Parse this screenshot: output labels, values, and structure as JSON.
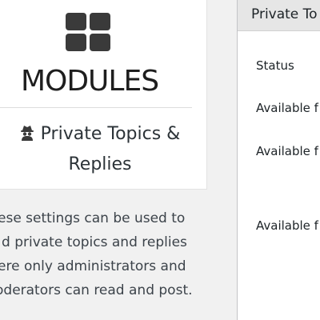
{
  "module_card": {
    "icon": "modules-grid-icon",
    "title": "MODULES",
    "module_icon": "spy-icon",
    "module_name": "Private Topics & Replies"
  },
  "description": {
    "lines": [
      "ese settings can be used to",
      "d private topics and replies",
      "ere only administrators and",
      "oderators can read and post."
    ]
  },
  "settings_panel": {
    "title": "Private To",
    "fields": [
      {
        "label": "Status"
      },
      {
        "label": "Available f"
      },
      {
        "label": "Available f"
      },
      {
        "label": "Available f"
      }
    ]
  },
  "colors": {
    "page_background": "#f1f1f1",
    "card_background": "#ffffff",
    "panel_header": "#e6e6e6",
    "icon_dark": "#3a3a3a"
  }
}
